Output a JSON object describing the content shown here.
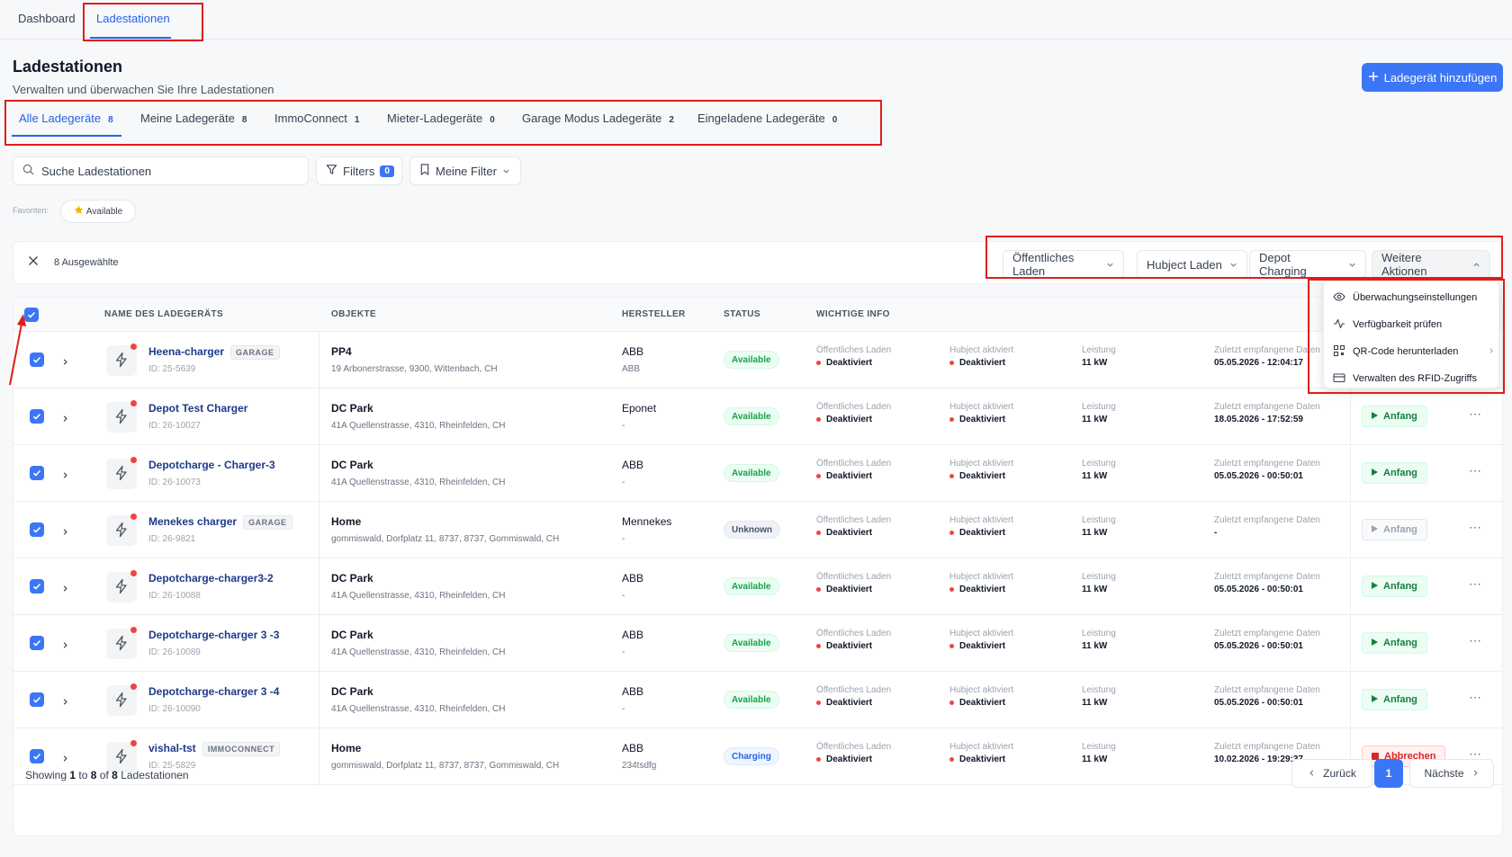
{
  "topnav": {
    "tabs": [
      "Dashboard",
      "Ladestationen"
    ],
    "active": "Ladestationen"
  },
  "page": {
    "title": "Ladestationen",
    "subtitle": "Verwalten und überwachen Sie Ihre Ladestationen",
    "add_button": "Ladegerät hinzufügen"
  },
  "subtabs": [
    {
      "label": "Alle Ladegeräte",
      "count": "8"
    },
    {
      "label": "Meine Ladegeräte",
      "count": "8"
    },
    {
      "label": "ImmoConnect",
      "count": "1"
    },
    {
      "label": "Mieter-Ladegeräte",
      "count": "0"
    },
    {
      "label": "Garage Modus Ladegeräte",
      "count": "2"
    },
    {
      "label": "Eingeladene Ladegeräte",
      "count": "0"
    }
  ],
  "toolbar": {
    "search_placeholder": "Suche Ladestationen",
    "filters_label": "Filters",
    "filters_count": "0",
    "my_filters_label": "Meine Filter"
  },
  "favorites": {
    "label": "Favoriten:",
    "chip": "Available"
  },
  "selection": {
    "count_label": "8 Ausgewählte",
    "actions": [
      "Öffentliches Laden",
      "Hubject Laden",
      "Depot Charging",
      "Weitere Aktionen"
    ]
  },
  "more_actions_menu": [
    {
      "label": "Überwachungseinstellungen",
      "icon": "eye-icon"
    },
    {
      "label": "Verfügbarkeit prüfen",
      "icon": "activity-icon"
    },
    {
      "label": "QR-Code herunterladen",
      "icon": "qr-code-icon",
      "has_submenu": true
    },
    {
      "label": "Verwalten des RFID-Zugriffs",
      "icon": "credit-card-icon"
    }
  ],
  "table": {
    "headers": [
      "NAME DES LADEGERÄTS",
      "OBJEKTE",
      "HERSTELLER",
      "STATUS",
      "WICHTIGE INFO"
    ],
    "info_labels": {
      "public": "Öffentliches Laden",
      "hubject": "Hubject aktiviert",
      "power": "Leistung",
      "last_data": "Zuletzt empfangene Daten"
    },
    "rows": [
      {
        "name": "Heena-charger",
        "tag": "GARAGE",
        "id": "ID: 25-5639",
        "object": "PP4",
        "address": "19 Arbonerstrasse, 9300, Wittenbach, CH",
        "manufacturer": "ABB",
        "manufacturer_sub": "ABB",
        "status": "Available",
        "status_type": "available",
        "public": "Deaktiviert",
        "hubject": "Deaktiviert",
        "power": "11 kW",
        "last_data": "05.05.2026 - 12:04:17",
        "action": "Anfang",
        "action_type": "start"
      },
      {
        "name": "Depot Test Charger",
        "tag": "",
        "id": "ID: 26-10027",
        "object": "DC Park",
        "address": "41A Quellenstrasse, 4310, Rheinfelden, CH",
        "manufacturer": "Eponet",
        "manufacturer_sub": "-",
        "status": "Available",
        "status_type": "available",
        "public": "Deaktiviert",
        "hubject": "Deaktiviert",
        "power": "11 kW",
        "last_data": "18.05.2026 - 17:52:59",
        "action": "Anfang",
        "action_type": "start"
      },
      {
        "name": "Depotcharge - Charger-3",
        "tag": "",
        "id": "ID: 26-10073",
        "object": "DC Park",
        "address": "41A Quellenstrasse, 4310, Rheinfelden, CH",
        "manufacturer": "ABB",
        "manufacturer_sub": "-",
        "status": "Available",
        "status_type": "available",
        "public": "Deaktiviert",
        "hubject": "Deaktiviert",
        "power": "11 kW",
        "last_data": "05.05.2026 - 00:50:01",
        "action": "Anfang",
        "action_type": "start"
      },
      {
        "name": "Menekes charger",
        "tag": "GARAGE",
        "id": "ID: 26-9821",
        "object": "Home",
        "address": "gommiswald, Dorfplatz 11, 8737, 8737, Gommiswald, CH",
        "manufacturer": "Mennekes",
        "manufacturer_sub": "-",
        "status": "Unknown",
        "status_type": "unknown",
        "public": "Deaktiviert",
        "hubject": "Deaktiviert",
        "power": "11 kW",
        "last_data": "-",
        "action": "Anfang",
        "action_type": "disabled"
      },
      {
        "name": "Depotcharge-charger3-2",
        "tag": "",
        "id": "ID: 26-10088",
        "object": "DC Park",
        "address": "41A Quellenstrasse, 4310, Rheinfelden, CH",
        "manufacturer": "ABB",
        "manufacturer_sub": "-",
        "status": "Available",
        "status_type": "available",
        "public": "Deaktiviert",
        "hubject": "Deaktiviert",
        "power": "11 kW",
        "last_data": "05.05.2026 - 00:50:01",
        "action": "Anfang",
        "action_type": "start"
      },
      {
        "name": "Depotcharge-charger 3 -3",
        "tag": "",
        "id": "ID: 26-10089",
        "object": "DC Park",
        "address": "41A Quellenstrasse, 4310, Rheinfelden, CH",
        "manufacturer": "ABB",
        "manufacturer_sub": "-",
        "status": "Available",
        "status_type": "available",
        "public": "Deaktiviert",
        "hubject": "Deaktiviert",
        "power": "11 kW",
        "last_data": "05.05.2026 - 00:50:01",
        "action": "Anfang",
        "action_type": "start"
      },
      {
        "name": "Depotcharge-charger 3 -4",
        "tag": "",
        "id": "ID: 26-10090",
        "object": "DC Park",
        "address": "41A Quellenstrasse, 4310, Rheinfelden, CH",
        "manufacturer": "ABB",
        "manufacturer_sub": "-",
        "status": "Available",
        "status_type": "available",
        "public": "Deaktiviert",
        "hubject": "Deaktiviert",
        "power": "11 kW",
        "last_data": "05.05.2026 - 00:50:01",
        "action": "Anfang",
        "action_type": "start"
      },
      {
        "name": "vishal-tst",
        "tag": "IMMOCONNECT",
        "id": "ID: 25-5829",
        "object": "Home",
        "address": "gommiswald, Dorfplatz 11, 8737, 8737, Gommiswald, CH",
        "manufacturer": "ABB",
        "manufacturer_sub": "234tsdfg",
        "status": "Charging",
        "status_type": "charging",
        "public": "Deaktiviert",
        "hubject": "Deaktiviert",
        "power": "11 kW",
        "last_data": "10.02.2026 - 19:29:37",
        "action": "Abbrechen",
        "action_type": "abort"
      }
    ]
  },
  "pagination": {
    "showing": "Showing",
    "from": "1",
    "to_word": "to",
    "to": "8",
    "of_word": "of",
    "total": "8",
    "suffix": "Ladestationen",
    "prev": "Zurück",
    "current": "1",
    "next": "Nächste"
  },
  "colors": {
    "accent": "#3b76f6",
    "annotation_red": "#e11d1d"
  }
}
